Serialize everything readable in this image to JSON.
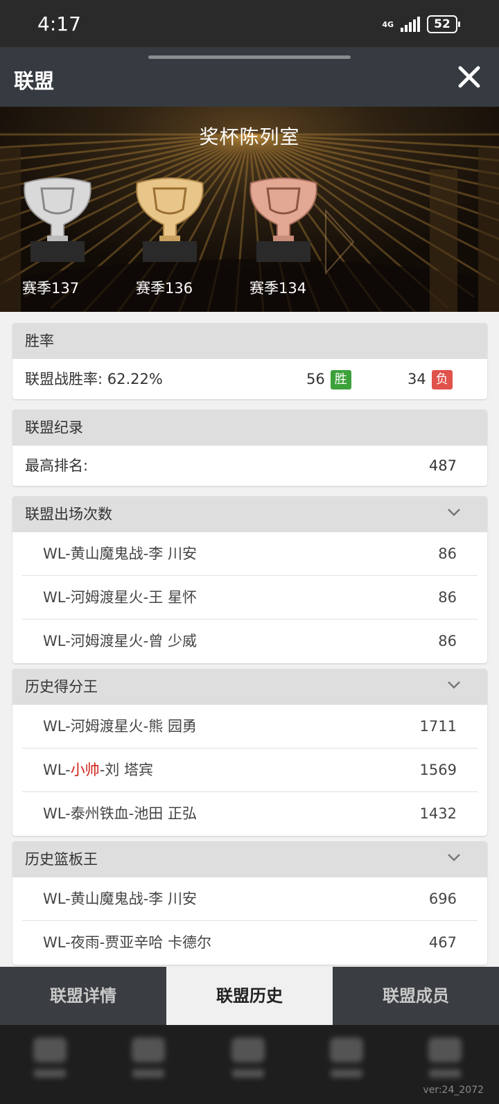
{
  "status": {
    "time": "4:17",
    "network": "4G",
    "battery": "52"
  },
  "header": {
    "title": "联盟"
  },
  "trophy_room": {
    "title": "奖杯陈列室",
    "trophies": [
      {
        "season": "赛季137",
        "tier": "silver"
      },
      {
        "season": "赛季136",
        "tier": "gold"
      },
      {
        "season": "赛季134",
        "tier": "bronze"
      }
    ]
  },
  "win_rate": {
    "title": "胜率",
    "label": "联盟战胜率: 62.22%",
    "wins": "56",
    "win_badge": "胜",
    "losses": "34",
    "loss_badge": "负"
  },
  "records": {
    "title": "联盟纪录",
    "best_rank_label": "最高排名:",
    "best_rank_value": "487"
  },
  "appearances": {
    "title": "联盟出场次数",
    "rows": [
      {
        "prefix": "WL-",
        "highlight": "",
        "name": "黄山魔鬼战-李 川安",
        "value": "86"
      },
      {
        "prefix": "WL-",
        "highlight": "",
        "name": "河姆渡星火-王 星怀",
        "value": "86"
      },
      {
        "prefix": "WL-",
        "highlight": "",
        "name": "河姆渡星火-曾 少威",
        "value": "86"
      }
    ]
  },
  "scorers": {
    "title": "历史得分王",
    "rows": [
      {
        "prefix": "WL-",
        "highlight": "",
        "name": "河姆渡星火-熊 园勇",
        "value": "1711"
      },
      {
        "prefix": "WL-",
        "highlight": "小帅",
        "name": "-刘 塔宾",
        "value": "1569"
      },
      {
        "prefix": "WL-",
        "highlight": "",
        "name": "泰州铁血-池田 正弘",
        "value": "1432"
      }
    ]
  },
  "rebounders": {
    "title": "历史篮板王",
    "rows": [
      {
        "prefix": "WL-",
        "highlight": "",
        "name": "黄山魔鬼战-李 川安",
        "value": "696"
      },
      {
        "prefix": "WL-",
        "highlight": "",
        "name": "夜雨-贾亚辛哈 卡德尔",
        "value": "467"
      }
    ]
  },
  "tabs": {
    "details": "联盟详情",
    "history": "联盟历史",
    "members": "联盟成员"
  },
  "version": "ver:24_2072",
  "colors": {
    "win": "#3ca13a",
    "loss": "#e0524b",
    "highlight": "#d0201a"
  }
}
